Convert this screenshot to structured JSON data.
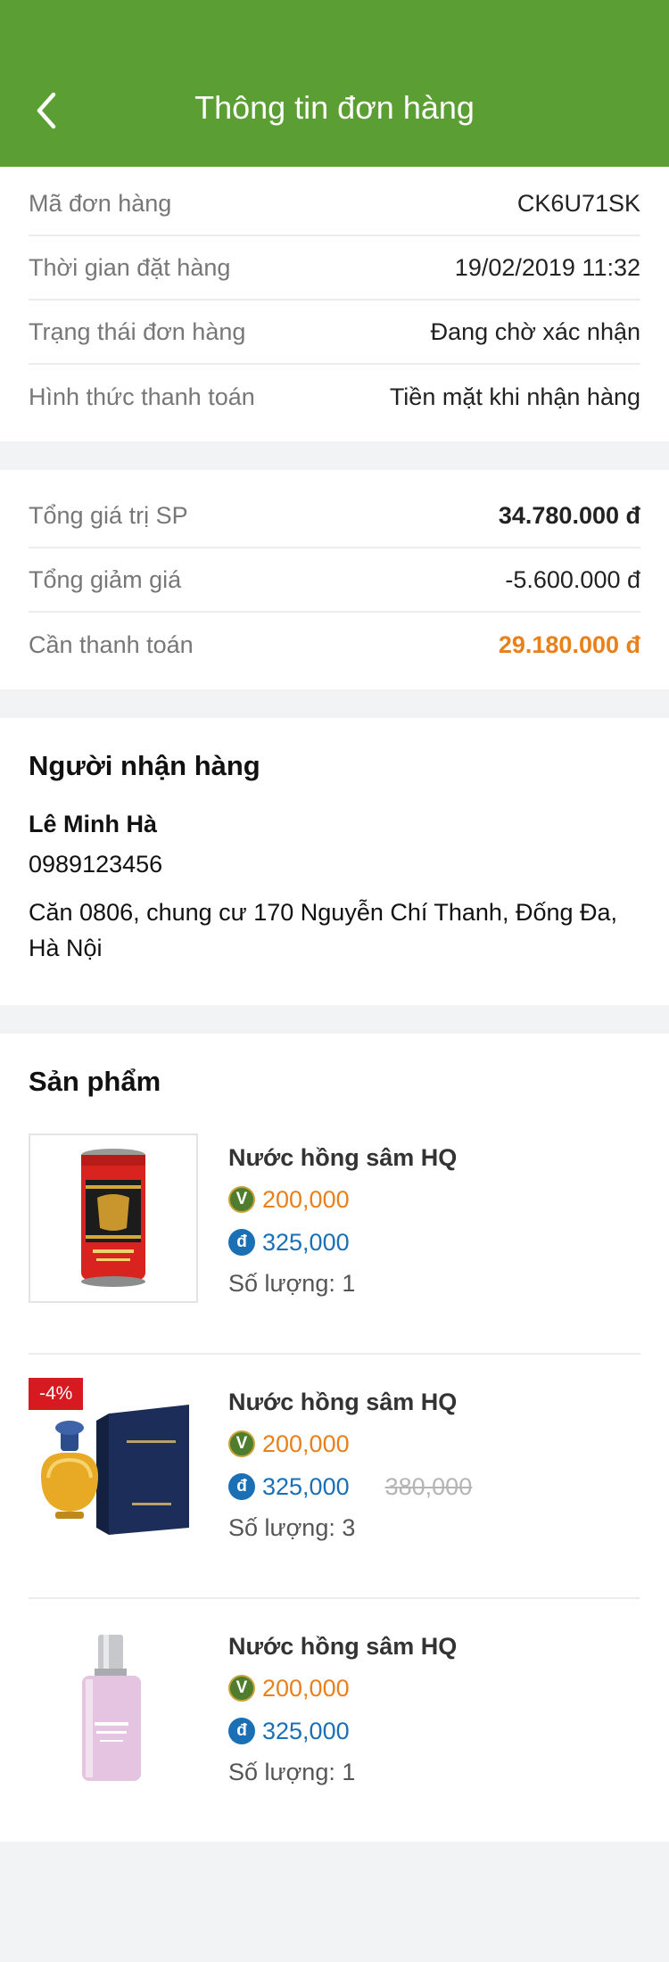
{
  "header": {
    "title": "Thông tin đơn hàng",
    "back_icon": "chevron-left-icon"
  },
  "order_info": [
    {
      "label": "Mã đơn hàng",
      "value": "CK6U71SK"
    },
    {
      "label": "Thời gian đặt hàng",
      "value": "19/02/2019 11:32"
    },
    {
      "label": "Trạng thái đơn hàng",
      "value": "Đang chờ xác nhận"
    },
    {
      "label": "Hình thức thanh toán",
      "value": "Tiền mặt khi nhận hàng"
    }
  ],
  "summary": {
    "total": {
      "label": "Tổng giá trị SP",
      "value": "34.780.000 đ"
    },
    "discount": {
      "label": "Tổng giảm giá",
      "value": "-5.600.000 đ"
    },
    "to_pay": {
      "label": "Cần thanh toán",
      "value": "29.180.000 đ"
    }
  },
  "receiver": {
    "title": "Người nhận hàng",
    "name": "Lê Minh Hà",
    "phone": "0989123456",
    "address": "Căn 0806, chung cư 170 Nguyễn Chí Thanh, Đống Đa, Hà Nội"
  },
  "products": {
    "title": "Sản phẩm",
    "items": [
      {
        "name": "Nước hồng sâm HQ",
        "points": "200,000",
        "price": "325,000",
        "old_price": "",
        "quantity": "Số lượng: 1",
        "badge": "",
        "image": "red-ginseng-can"
      },
      {
        "name": "Nước hồng sâm HQ",
        "points": "200,000",
        "price": "325,000",
        "old_price": "380,000",
        "quantity": "Số lượng: 3",
        "badge": "-4%",
        "image": "shalimar-perfume"
      },
      {
        "name": "Nước hồng sâm HQ",
        "points": "200,000",
        "price": "325,000",
        "old_price": "",
        "quantity": "Số lượng: 1",
        "badge": "",
        "image": "musc-ambre-perfume"
      }
    ]
  },
  "icons": {
    "points_glyph": "V",
    "currency_glyph": "đ"
  },
  "colors": {
    "header": "#5a9e34",
    "accent_orange": "#e8801c",
    "accent_blue": "#1a6fb5",
    "badge": "#d71920"
  }
}
